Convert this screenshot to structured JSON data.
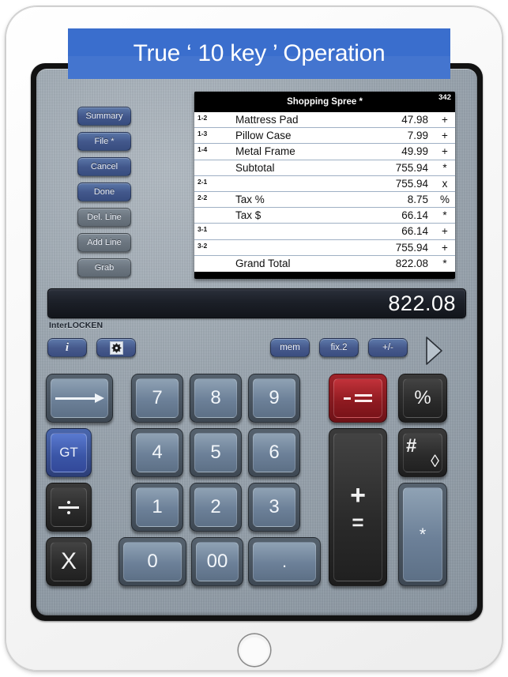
{
  "banner": {
    "title": "True ‘ 10 key ’ Operation",
    "color": "#3a6ecd"
  },
  "device": {
    "kind": "ipad-white"
  },
  "side_buttons": [
    {
      "label": "Summary",
      "style": "blue"
    },
    {
      "label": "File *",
      "style": "blue"
    },
    {
      "label": "Cancel",
      "style": "blue"
    },
    {
      "label": "Done",
      "style": "blue"
    },
    {
      "label": "Del. Line",
      "style": "gray"
    },
    {
      "label": "Add Line",
      "style": "gray"
    },
    {
      "label": "Grab",
      "style": "gray"
    }
  ],
  "tape": {
    "title": "Shopping Spree *",
    "count": "342",
    "rows": [
      {
        "num": "1-2",
        "label": "Mattress Pad",
        "indent": true,
        "value": "47.98",
        "op": "+"
      },
      {
        "num": "1-3",
        "label": "Pillow Case",
        "indent": true,
        "value": "7.99",
        "op": "+"
      },
      {
        "num": "1-4",
        "label": "Metal Frame",
        "indent": true,
        "value": "49.99",
        "op": "+"
      },
      {
        "num": "",
        "label": "Subtotal",
        "indent": true,
        "value": "755.94",
        "op": "*"
      },
      {
        "num": "2-1",
        "label": "",
        "indent": false,
        "value": "755.94",
        "op": "x"
      },
      {
        "num": "2-2",
        "label": "Tax %",
        "indent": true,
        "value": "8.75",
        "op": "%"
      },
      {
        "num": "",
        "label": "Tax $",
        "indent": true,
        "value": "66.14",
        "op": "*"
      },
      {
        "num": "3-1",
        "label": "",
        "indent": false,
        "value": "66.14",
        "op": "+"
      },
      {
        "num": "3-2",
        "label": "",
        "indent": false,
        "value": "755.94",
        "op": "+"
      },
      {
        "num": "",
        "label": "Grand Total",
        "indent": true,
        "value": "822.08",
        "op": "*"
      }
    ]
  },
  "display": {
    "value": "822.08"
  },
  "brand": {
    "name": "InterLOCKEN"
  },
  "toolbar": {
    "info_label": "i",
    "settings_icon": "gear-icon",
    "mem_label": "mem",
    "fix_label": "fix.2",
    "plusminus_label": "+/-",
    "next_icon": "triangle-right-icon"
  },
  "keypad": {
    "tab_icon": "arrow-right-icon",
    "gt_label": "GT",
    "divide_label": "÷",
    "multiply_label": "X",
    "k7": "7",
    "k8": "8",
    "k9": "9",
    "k4": "4",
    "k5": "5",
    "k6": "6",
    "k1": "1",
    "k2": "2",
    "k3": "3",
    "k0": "0",
    "k00": "00",
    "kdot": ".",
    "minus_equals_label": "-=",
    "plus_label": "+",
    "equals_label": "=",
    "percent_label": "%",
    "hash_label": "#",
    "diamond_label": "◊",
    "asterisk_label": "*"
  }
}
